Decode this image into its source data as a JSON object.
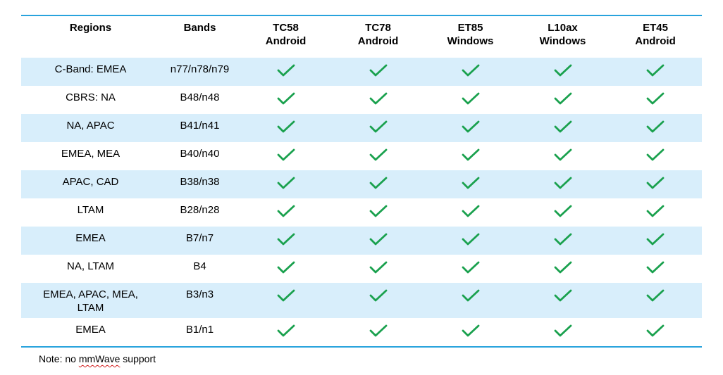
{
  "columns": [
    {
      "line1": "Regions",
      "line2": ""
    },
    {
      "line1": "Bands",
      "line2": ""
    },
    {
      "line1": "TC58",
      "line2": "Android"
    },
    {
      "line1": "TC78",
      "line2": "Android"
    },
    {
      "line1": "ET85",
      "line2": "Windows"
    },
    {
      "line1": "L10ax",
      "line2": "Windows"
    },
    {
      "line1": "ET45",
      "line2": "Android"
    }
  ],
  "rows": [
    {
      "region": "C-Band: EMEA",
      "band": "n77/n78/n79"
    },
    {
      "region": "CBRS: NA",
      "band": "B48/n48"
    },
    {
      "region": "NA, APAC",
      "band": "B41/n41"
    },
    {
      "region": "EMEA, MEA",
      "band": "B40/n40"
    },
    {
      "region": "APAC, CAD",
      "band": "B38/n38"
    },
    {
      "region": "LTAM",
      "band": "B28/n28"
    },
    {
      "region": "EMEA",
      "band": "B7/n7"
    },
    {
      "region": "NA, LTAM",
      "band": "B4"
    },
    {
      "region": "EMEA, APAC, MEA, LTAM",
      "region_line1": "EMEA, APAC, MEA,",
      "region_line2": "LTAM",
      "band": "B3/n3"
    },
    {
      "region": "EMEA",
      "band": "B1/n1"
    }
  ],
  "support_icon": "checkmark-icon",
  "colors": {
    "check": "#1aa14e",
    "stripe": "#d8eefb",
    "rule": "#29a3dd"
  },
  "note": {
    "prefix": "Note: no ",
    "term": "mmWave",
    "suffix": " support"
  }
}
